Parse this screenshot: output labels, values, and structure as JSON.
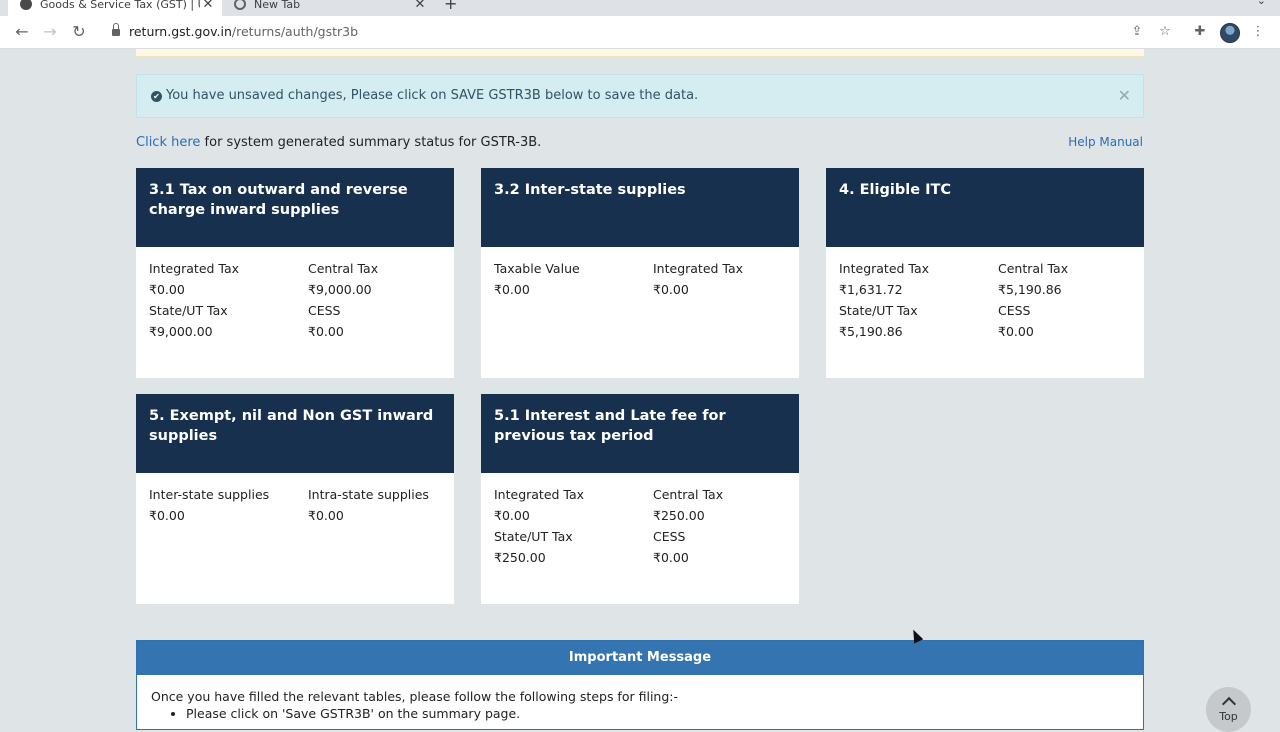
{
  "browser": {
    "tabs": [
      {
        "title": "Goods & Service Tax (GST) | U"
      },
      {
        "title": "New Tab"
      }
    ],
    "url_host": "return.gst.gov.in",
    "url_path": "/returns/auth/gstr3b"
  },
  "alert": {
    "message": "You have unsaved changes, Please click on SAVE GSTR3B below to save the data."
  },
  "summary_link": {
    "link_text": "Click here",
    "rest_text": " for system generated summary status for GSTR-3B."
  },
  "help_manual": "Help Manual",
  "tiles": [
    {
      "title": "3.1 Tax on outward and reverse charge inward supplies",
      "fields": [
        {
          "label": "Integrated Tax",
          "value": "₹0.00"
        },
        {
          "label": "Central Tax",
          "value": "₹9,000.00"
        },
        {
          "label": "State/UT Tax",
          "value": "₹9,000.00"
        },
        {
          "label": "CESS",
          "value": "₹0.00"
        }
      ]
    },
    {
      "title": "3.2 Inter-state supplies",
      "fields": [
        {
          "label": "Taxable Value",
          "value": "₹0.00"
        },
        {
          "label": "Integrated Tax",
          "value": "₹0.00"
        }
      ]
    },
    {
      "title": "4. Eligible ITC",
      "fields": [
        {
          "label": "Integrated Tax",
          "value": "₹1,631.72"
        },
        {
          "label": "Central Tax",
          "value": "₹5,190.86"
        },
        {
          "label": "State/UT Tax",
          "value": "₹5,190.86"
        },
        {
          "label": "CESS",
          "value": "₹0.00"
        }
      ]
    },
    {
      "title": "5. Exempt, nil and Non GST inward supplies",
      "fields": [
        {
          "label": "Inter-state supplies",
          "value": "₹0.00"
        },
        {
          "label": "Intra-state supplies",
          "value": "₹0.00"
        }
      ]
    },
    {
      "title": "5.1 Interest and Late fee for previous tax period",
      "fields": [
        {
          "label": "Integrated Tax",
          "value": "₹0.00"
        },
        {
          "label": "Central Tax",
          "value": "₹250.00"
        },
        {
          "label": "State/UT Tax",
          "value": "₹250.00"
        },
        {
          "label": "CESS",
          "value": "₹0.00"
        }
      ]
    }
  ],
  "important": {
    "title": "Important Message",
    "intro": "Once you have filled the relevant tables, please follow the following steps for filing:-",
    "steps": [
      "Please click on 'Save GSTR3B' on the summary page."
    ]
  },
  "top_button": "Top",
  "colors": {
    "tile_header": "#17304d",
    "alert_bg": "#d5ecf1",
    "link": "#2a6db4",
    "important_bar": "#3474b0"
  }
}
